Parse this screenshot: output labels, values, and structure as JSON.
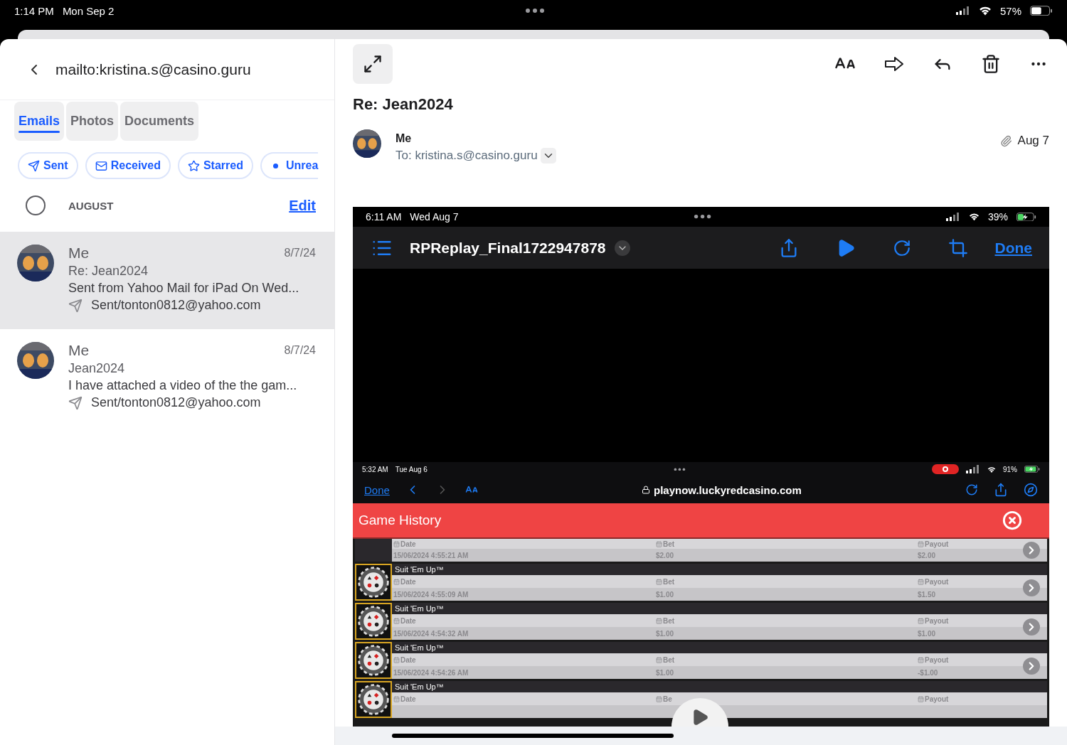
{
  "status_bar": {
    "time": "1:14 PM",
    "date": "Mon Sep 2",
    "battery": "57%"
  },
  "sidebar": {
    "title": "mailto:kristina.s@casino.guru",
    "tabs": [
      {
        "label": "Emails",
        "selected": true
      },
      {
        "label": "Photos",
        "selected": false
      },
      {
        "label": "Documents",
        "selected": false
      }
    ],
    "filters": [
      {
        "label": "Sent",
        "kind": "sent"
      },
      {
        "label": "Received",
        "kind": "received"
      },
      {
        "label": "Starred",
        "kind": "starred"
      },
      {
        "label": "Unrea",
        "kind": "unread"
      }
    ],
    "section": {
      "label": "AUGUST",
      "checked": false,
      "action": "Edit"
    },
    "messages": [
      {
        "sender": "Me",
        "date": "8/7/24",
        "subject": "Re: Jean2024",
        "preview": "Sent from Yahoo Mail for iPad On Wed...",
        "folder": "Sent/tonton0812@yahoo.com",
        "selected": true
      },
      {
        "sender": "Me",
        "date": "8/7/24",
        "subject": "Jean2024",
        "preview": "I have attached a video of the the gam...",
        "folder": "Sent/tonton0812@yahoo.com",
        "selected": false
      }
    ]
  },
  "message": {
    "subject": "Re: Jean2024",
    "sender": "Me",
    "to": "To: kristina.s@casino.guru",
    "date": "Aug 7",
    "attachment": {
      "status": {
        "time": "6:11 AM",
        "date": "Wed Aug 7",
        "battery": "39%"
      },
      "title": "RPReplay_Final1722947878",
      "done": "Done",
      "screen": {
        "status": {
          "time": "5:32 AM",
          "date": "Tue Aug 6",
          "battery": "91%"
        },
        "done": "Done",
        "url": "playnow.luckyredcasino.com",
        "header": "Game History",
        "rows": [
          {
            "date_label": "Date",
            "date": "15/06/2024 4:55:21 AM",
            "bet_label": "Bet",
            "bet": "$2.00",
            "payout_label": "Payout",
            "payout": "$2.00"
          },
          {
            "game": "Suit 'Em Up™",
            "date_label": "Date",
            "date": "15/06/2024 4:55:09 AM",
            "bet_label": "Bet",
            "bet": "$1.00",
            "payout_label": "Payout",
            "payout": "$1.50"
          },
          {
            "game": "Suit 'Em Up™",
            "date_label": "Date",
            "date": "15/06/2024 4:54:32 AM",
            "bet_label": "Bet",
            "bet": "$1.00",
            "payout_label": "Payout",
            "payout": "$1.00"
          },
          {
            "game": "Suit 'Em Up™",
            "date_label": "Date",
            "date": "15/06/2024 4:54:26 AM",
            "bet_label": "Bet",
            "bet": "$1.00",
            "payout_label": "Payout",
            "payout": "-$1.00"
          },
          {
            "game": "Suit 'Em Up™",
            "date_label": "Date",
            "bet_label": "Be",
            "payout_label": "Payout"
          }
        ]
      }
    }
  }
}
